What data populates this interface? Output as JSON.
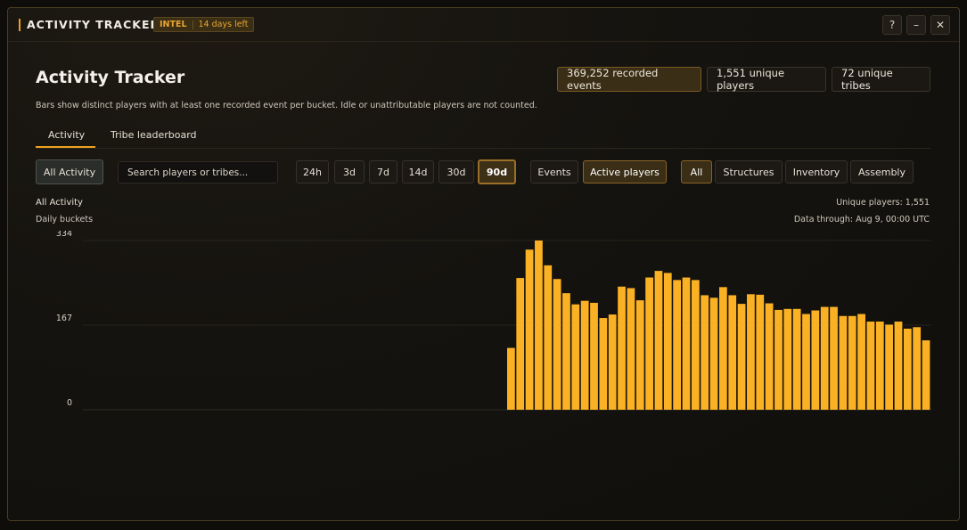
{
  "window": {
    "title": "ACTIVITY TRACKER",
    "badge_tier": "INTEL",
    "badge_days": "14 days left",
    "help_label": "?",
    "minimize_label": "–",
    "close_label": "✕"
  },
  "header": {
    "title": "Activity Tracker",
    "subtitle": "Bars show distinct players with at least one recorded event per bucket. Idle or unattributable players are not counted.",
    "stats": {
      "events": "369,252 recorded events",
      "players": "1,551 unique players",
      "tribes": "72 unique tribes"
    }
  },
  "tabs": {
    "activity": "Activity",
    "tribe_leaderboard": "Tribe leaderboard"
  },
  "filters": {
    "all_activity": "All Activity",
    "search_placeholder": "Search players or tribes...",
    "ranges": [
      "24h",
      "3d",
      "7d",
      "14d",
      "30d",
      "90d"
    ],
    "selected_range": "90d",
    "metrics": [
      "Events",
      "Active players"
    ],
    "selected_metric": "Active players",
    "categories": [
      "All",
      "Structures",
      "Inventory",
      "Assembly"
    ],
    "selected_category": "All"
  },
  "chart_header": {
    "scope": "All Activity",
    "bucket": "Daily buckets",
    "unique_players": "Unique players: 1,551",
    "data_through": "Data through: Aug 9, 00:00 UTC"
  },
  "colors": {
    "accent": "#f0a020",
    "bar": "#fbb124"
  },
  "chart_data": {
    "type": "bar",
    "title": "",
    "xlabel": "",
    "ylabel": "",
    "ylim": [
      0,
      334
    ],
    "yticks": [
      0,
      167,
      334
    ],
    "bucket_count": 90,
    "values": [
      0,
      0,
      0,
      0,
      0,
      0,
      0,
      0,
      0,
      0,
      0,
      0,
      0,
      0,
      0,
      0,
      0,
      0,
      0,
      0,
      0,
      0,
      0,
      0,
      0,
      0,
      0,
      0,
      0,
      0,
      0,
      0,
      0,
      0,
      0,
      0,
      0,
      0,
      0,
      0,
      0,
      0,
      0,
      0,
      0,
      0,
      122,
      260,
      316,
      334,
      285,
      258,
      230,
      208,
      215,
      211,
      181,
      188,
      243,
      240,
      216,
      261,
      274,
      270,
      256,
      261,
      256,
      226,
      221,
      242,
      226,
      209,
      228,
      227,
      210,
      197,
      199,
      199,
      189,
      196,
      203,
      203,
      185,
      185,
      189,
      174,
      174,
      168,
      174,
      160,
      163,
      137
    ]
  }
}
